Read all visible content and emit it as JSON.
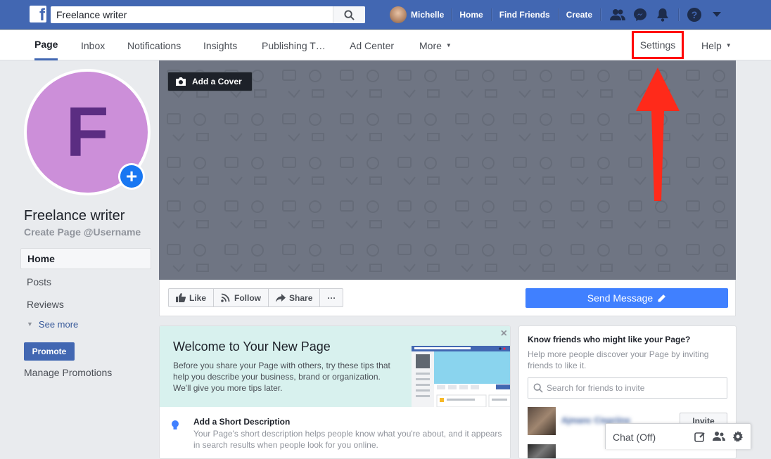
{
  "topbar": {
    "search_value": "Freelance writer",
    "profile_name": "Michelle",
    "links": [
      "Home",
      "Find Friends",
      "Create"
    ],
    "brand_color": "#4267b2"
  },
  "pagebar": {
    "tabs": [
      "Page",
      "Inbox",
      "Notifications",
      "Insights",
      "Publishing T…",
      "Ad Center",
      "More"
    ],
    "settings_label": "Settings",
    "help_label": "Help"
  },
  "left": {
    "initial": "F",
    "page_name": "Freelance writer",
    "username_prompt": "Create Page @Username",
    "nav": [
      "Home",
      "Posts",
      "Reviews"
    ],
    "see_more": "See more",
    "promote": "Promote",
    "manage_promotions": "Manage Promotions"
  },
  "cover": {
    "add_cover": "Add a Cover"
  },
  "actions": {
    "like": "Like",
    "follow": "Follow",
    "share": "Share",
    "more": "···",
    "send_message": "Send Message"
  },
  "welcome": {
    "title": "Welcome to Your New Page",
    "text": "Before you share your Page with others, try these tips that help you describe your business, brand or organization. We'll give you more tips later.",
    "close": "×",
    "tip_title": "Add a Short Description",
    "tip_text": "Your Page's short description helps people know what you're about, and it appears in search results when people look for you online."
  },
  "invite": {
    "title": "Know friends who might like your Page?",
    "subtitle": "Help more people discover your Page by inviting friends to like it.",
    "search_placeholder": "Search for friends to invite",
    "friend_name": "Ajmanc Ciepriine",
    "invite_label": "Invite"
  },
  "chat": {
    "label": "Chat (Off)"
  },
  "annotation": {
    "highlight_color": "#ff0000"
  }
}
